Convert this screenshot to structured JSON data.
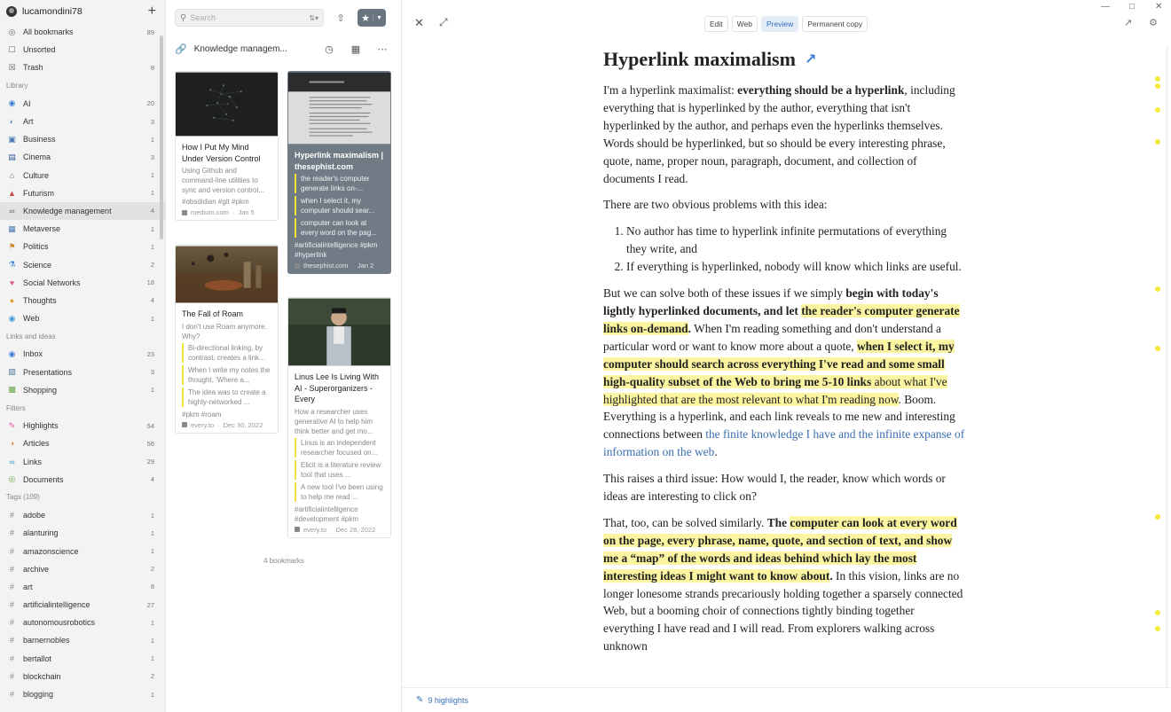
{
  "sidebar": {
    "username": "lucamondini78",
    "top_items": [
      {
        "label": "All bookmarks",
        "count": "89",
        "icon": "bookmark-icon"
      },
      {
        "label": "Unsorted",
        "count": "",
        "icon": "inbox-tray-icon"
      },
      {
        "label": "Trash",
        "count": "8",
        "icon": "trash-icon"
      }
    ],
    "library_title": "Library",
    "library_items": [
      {
        "label": "AI",
        "count": "20",
        "icon": "globe-icon",
        "color": "#3a7bd5"
      },
      {
        "label": "Art",
        "count": "3",
        "icon": "palette-icon",
        "color": "#6b8fb5"
      },
      {
        "label": "Business",
        "count": "1",
        "icon": "briefcase-icon",
        "color": "#4a78b0"
      },
      {
        "label": "Cinema",
        "count": "3",
        "icon": "film-icon",
        "color": "#2e5a9a"
      },
      {
        "label": "Culture",
        "count": "1",
        "icon": "museum-icon",
        "color": "#8a6a4a"
      },
      {
        "label": "Futurism",
        "count": "1",
        "icon": "rocket-icon",
        "color": "#c94a4a"
      },
      {
        "label": "Knowledge management",
        "count": "4",
        "icon": "link-icon",
        "color": "#666666"
      },
      {
        "label": "Metaverse",
        "count": "1",
        "icon": "metaverse-icon",
        "color": "#4a7ab5"
      },
      {
        "label": "Politics",
        "count": "1",
        "icon": "politics-icon",
        "color": "#d08a3a"
      },
      {
        "label": "Science",
        "count": "2",
        "icon": "flask-icon",
        "color": "#3a8ad5"
      },
      {
        "label": "Social Networks",
        "count": "18",
        "icon": "social-icon",
        "color": "#e05a8a"
      },
      {
        "label": "Thoughts",
        "count": "4",
        "icon": "thought-icon",
        "color": "#d9a23a"
      },
      {
        "label": "Web",
        "count": "1",
        "icon": "web-globe-icon",
        "color": "#3a9ad5"
      }
    ],
    "links_title": "Links and ideas",
    "links_items": [
      {
        "label": "Inbox",
        "count": "23",
        "icon": "inbox-icon",
        "color": "#3a7bd5"
      },
      {
        "label": "Presentations",
        "count": "3",
        "icon": "presentation-icon",
        "color": "#5a7aa0"
      },
      {
        "label": "Shopping",
        "count": "1",
        "icon": "shopping-icon",
        "color": "#6aa84f"
      }
    ],
    "filters_title": "Filters",
    "filter_items": [
      {
        "label": "Highlights",
        "count": "54",
        "icon": "highlighter-icon",
        "color": "#e05aa0"
      },
      {
        "label": "Articles",
        "count": "56",
        "icon": "article-icon",
        "color": "#e08a3a"
      },
      {
        "label": "Links",
        "count": "29",
        "icon": "links-icon",
        "color": "#3a9ad5"
      },
      {
        "label": "Documents",
        "count": "4",
        "icon": "document-icon",
        "color": "#6aa84f"
      }
    ],
    "tags_title": "Tags (109)",
    "tag_items": [
      {
        "label": "adobe",
        "count": "1"
      },
      {
        "label": "alanturing",
        "count": "1"
      },
      {
        "label": "amazonscience",
        "count": "1"
      },
      {
        "label": "archive",
        "count": "2"
      },
      {
        "label": "art",
        "count": "8"
      },
      {
        "label": "artificialintelligence",
        "count": "27"
      },
      {
        "label": "autonomousrobotics",
        "count": "1"
      },
      {
        "label": "barnernobles",
        "count": "1"
      },
      {
        "label": "bertallot",
        "count": "1"
      },
      {
        "label": "blockchain",
        "count": "2"
      },
      {
        "label": "blogging",
        "count": "1"
      }
    ]
  },
  "middle": {
    "search_placeholder": "Search",
    "collection_title": "Knowledge managem...",
    "bookmark_count": "4 bookmarks",
    "cards": [
      {
        "title": "How I Put My Mind Under Version Control",
        "desc": "Using Github and command-line utilities to sync and version control...",
        "highlights": [],
        "tags": "#obsdidian  #git  #pkm",
        "domain": "medium.com",
        "date": "Jan 5"
      },
      {
        "title": "Hyperlink maximalism | thesephist.com",
        "desc": "",
        "highlights": [
          "the reader's computer generate links on-...",
          "when I select it, my computer should sear...",
          "computer can look at every word on the pag..."
        ],
        "tags": "#artificialintelligence  #pkm  #hyperlink",
        "domain": "thesephist.com",
        "date": "Jan 2"
      },
      {
        "title": "The Fall of Roam",
        "desc": "I don't use Roam anymore. Why?",
        "highlights": [
          "Bi-directional linking, by contrast, creates a link...",
          "When I write my notes the thought, 'Where a...",
          "The idea was to create a highly-networked ..."
        ],
        "tags": "#pkm  #roam",
        "domain": "every.to",
        "date": "Dec 30, 2022"
      },
      {
        "title": "Linus Lee Is Living With AI - Superorganizers - Every",
        "desc": "How a researcher uses generative AI to help him think better and get mo...",
        "highlights": [
          "Linus is an independent researcher focused on...",
          "Elicit is a literature review tool that uses ...",
          "A new tool I've been using to help me read ..."
        ],
        "tags": "#artificialintelligence  #development  #pkm",
        "domain": "every.to",
        "date": "Dec 28, 2022"
      }
    ]
  },
  "reader": {
    "tabs": [
      "Edit",
      "Web",
      "Preview",
      "Permanent copy"
    ],
    "active_tab": "Preview",
    "title": "Hyperlink maximalism",
    "p1_a": "I'm a hyperlink maximalist: ",
    "p1_b": "everything should be a hyperlink",
    "p1_c": ", including everything that is hyperlinked by the author, everything that isn't hyperlinked by the author, and perhaps even the hyperlinks themselves. Words should be hyperlinked, but so should be every interesting phrase, quote, name, proper noun, paragraph, document, and collection of documents I read.",
    "p2": "There are two obvious problems with this idea:",
    "li1": "No author has time to hyperlink infinite permutations of everything they write, and",
    "li2": "If everything is hyperlinked, nobody will know which links are useful.",
    "p3_a": "But we can solve both of these issues if we simply ",
    "p3_b": "begin with today's lightly hyperlinked documents, and let ",
    "p3_c": "the reader's computer generate links on-demand",
    "p3_d": ".",
    "p3_e": " When I'm reading something and don't understand a particular word or want to know more about a quote, ",
    "p3_f": "when I select it, my computer should search across everything I've read and some small high-quality subset of the Web to bring me 5-10 links",
    "p3_g": " about what I've highlighted that are the most relevant to what I'm reading now",
    "p3_h": ". Boom. Everything is a hyperlink, and each link reveals to me new and interesting connections between ",
    "p3_link": "the finite knowledge I have and the infinite expanse of information on the web",
    "p3_i": ".",
    "p4": "This raises a third issue: How would I, the reader, know which words or ideas are interesting to click on?",
    "p5_a": "That, too, can be solved similarly. ",
    "p5_b": "The ",
    "p5_c": "computer can look at every word on the page, every phrase, name, quote, and section of text, and show me a “map” of the words and ideas behind which lay the most interesting ideas I might want to know about",
    "p5_d": ".",
    "p5_e": " In this vision, links are no longer lonesome strands precariously holding together a sparsely connected Web, but a booming choir of connections tightly binding together everything I have read and I will read. From explorers walking across unknown",
    "highlights_label": "9 highlights"
  }
}
